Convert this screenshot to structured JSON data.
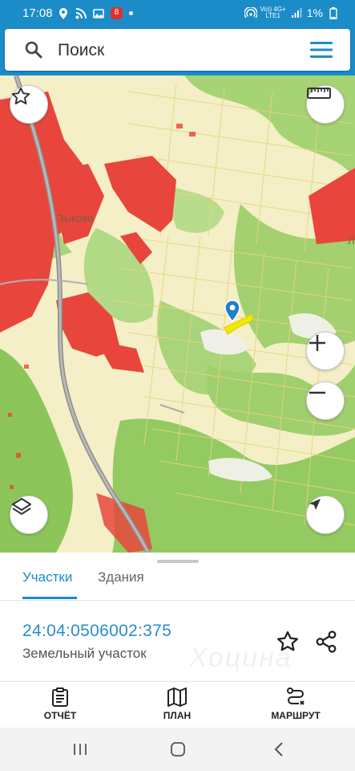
{
  "status_bar": {
    "time": "17:08",
    "battery": "1%",
    "network_top": "Vo)) 4G+",
    "network_bottom": "LTE1",
    "notification_badge": "8"
  },
  "search": {
    "placeholder": "Поиск"
  },
  "map": {
    "town_label": "Зыково",
    "edge_label": "Л",
    "colors": {
      "built_up": "#e8463c",
      "forest": "#9fcf6b",
      "fields": "#f3efc4",
      "parcel_border": "#e9d888",
      "selected_parcel": "#f5e800",
      "marker": "#1f7fc7",
      "road": "#9a9a9a"
    }
  },
  "tabs": [
    {
      "label": "Участки",
      "active": true
    },
    {
      "label": "Здания",
      "active": false
    }
  ],
  "parcel": {
    "cadastral_number": "24:04:0506002:375",
    "type": "Земельный участок"
  },
  "watermark": "Хоцина",
  "actions": {
    "report": "ОТЧЁТ",
    "plan": "ПЛАН",
    "route": "МАРШРУТ"
  },
  "accent_color": "#1c8cc9"
}
